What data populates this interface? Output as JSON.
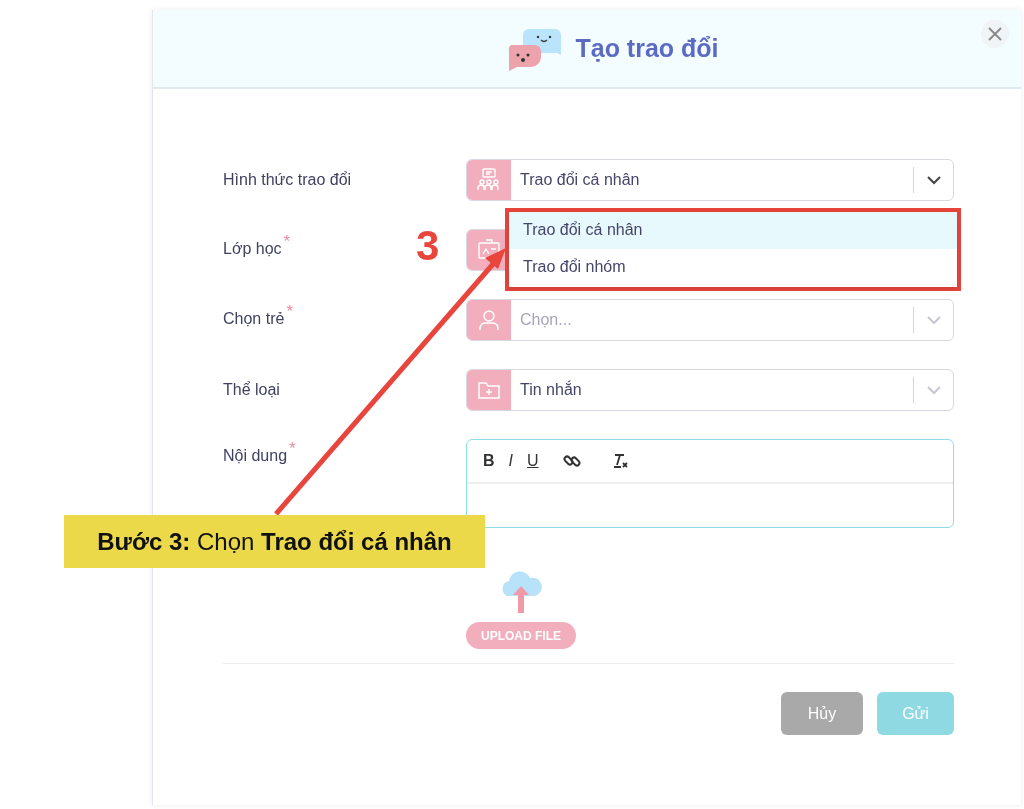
{
  "dialog": {
    "title": "Tạo trao đổi",
    "fields": [
      {
        "kind": "select",
        "label": "Hình thức trao đổi",
        "value": "Trao đổi cá nhân",
        "expanded": true
      },
      {
        "kind": "select",
        "label": "Lớp học",
        "required_mark": "*"
      },
      {
        "kind": "select",
        "label": "Chọn trẻ",
        "required_mark": "*",
        "placeholder": "Chọn...",
        "expanded": false
      },
      {
        "kind": "select",
        "label": "Thể loại",
        "value": "Tin nhắn",
        "expanded": false
      },
      {
        "kind": "editor",
        "label": "Nội dung",
        "required_mark": "*",
        "toolbar": [
          {
            "kind": "bold",
            "text": "B"
          },
          {
            "kind": "italic",
            "text": "I"
          },
          {
            "kind": "underline",
            "text": "U"
          },
          {
            "kind": "link"
          },
          {
            "kind": "clear"
          }
        ]
      }
    ],
    "dropdown": {
      "options": [
        {
          "label": "Trao đổi cá nhân",
          "selected": true
        },
        {
          "label": "Trao đổi nhóm",
          "selected": false
        }
      ]
    },
    "upload": {
      "button": "UPLOAD FILE"
    },
    "buttons": [
      {
        "kind": "cancel",
        "label": "Hủy"
      },
      {
        "kind": "submit",
        "label": "Gửi"
      }
    ]
  },
  "annotation": {
    "step_number": "3",
    "callout": "**Bước 3:** Chọn **Trao đổi cá nhân**"
  }
}
